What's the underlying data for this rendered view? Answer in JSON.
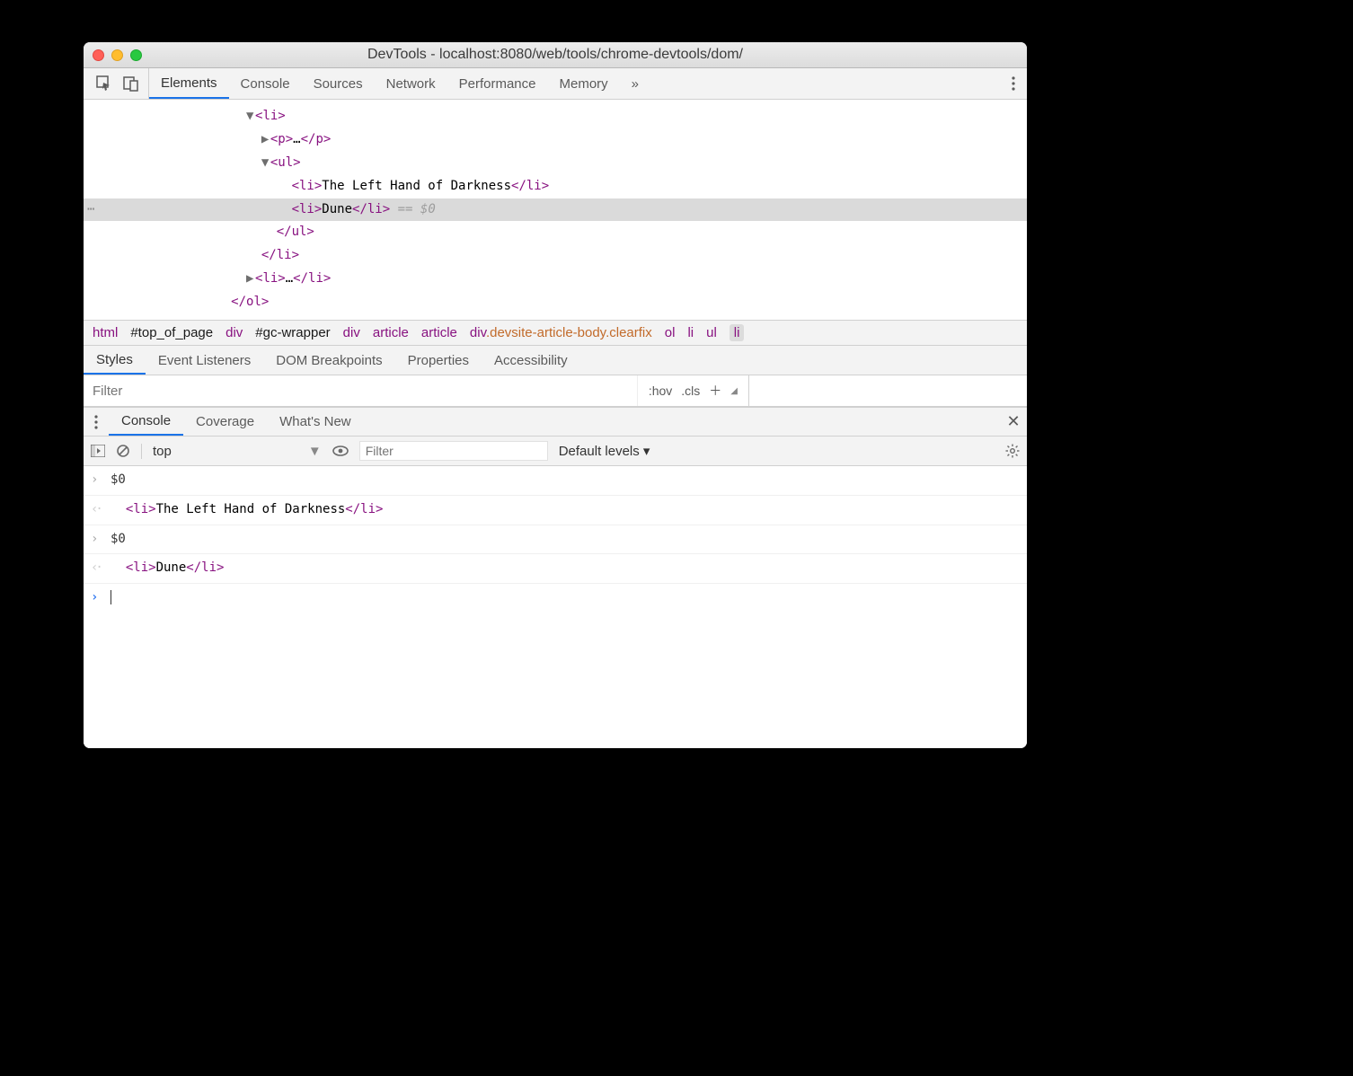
{
  "window": {
    "title": "DevTools - localhost:8080/web/tools/chrome-devtools/dom/"
  },
  "main_tabs": [
    "Elements",
    "Console",
    "Sources",
    "Network",
    "Performance",
    "Memory"
  ],
  "main_tab_active": 0,
  "dom": {
    "r0": "<li>",
    "r1a": "<p>",
    "r1b": "…",
    "r1c": "</p>",
    "r2": "<ul>",
    "r3a": "<li>",
    "r3txt": "The Left Hand of Darkness",
    "r3b": "</li>",
    "r4a": "<li>",
    "r4txt": "Dune",
    "r4b": "</li>",
    "r4c": " == $0",
    "r5": "</ul>",
    "r6": "</li>",
    "r7a": "<li>",
    "r7b": "…",
    "r7c": "</li>",
    "r8": "</ol>"
  },
  "crumbs": [
    {
      "text": "html",
      "kind": "tag"
    },
    {
      "text": "#top_of_page",
      "kind": "sel"
    },
    {
      "text": "div",
      "kind": "tag"
    },
    {
      "text": "#gc-wrapper",
      "kind": "sel"
    },
    {
      "text": "div",
      "kind": "tag"
    },
    {
      "text": "article",
      "kind": "tag"
    },
    {
      "text": "article",
      "kind": "tag"
    },
    {
      "tag": "div",
      "cls": ".devsite-article-body.clearfix",
      "kind": "mix"
    },
    {
      "text": "ol",
      "kind": "tag"
    },
    {
      "text": "li",
      "kind": "tag"
    },
    {
      "text": "ul",
      "kind": "tag"
    },
    {
      "text": "li",
      "kind": "tag",
      "current": true
    }
  ],
  "styles_tabs": [
    "Styles",
    "Event Listeners",
    "DOM Breakpoints",
    "Properties",
    "Accessibility"
  ],
  "styles_tab_active": 0,
  "filter_placeholder": "Filter",
  "filter_btns": {
    "hov": ":hov",
    "cls": ".cls"
  },
  "drawer_tabs": [
    "Console",
    "Coverage",
    "What's New"
  ],
  "drawer_tab_active": 0,
  "console_toolbar": {
    "context": "top",
    "filter_placeholder": "Filter",
    "levels": "Default levels ▾"
  },
  "console": [
    {
      "kind": "in",
      "text": "$0"
    },
    {
      "kind": "out",
      "tagOpen": "<li>",
      "content": "The Left Hand of Darkness",
      "tagClose": "</li>"
    },
    {
      "kind": "in",
      "text": "$0"
    },
    {
      "kind": "out",
      "tagOpen": "<li>",
      "content": "Dune",
      "tagClose": "</li>"
    }
  ]
}
